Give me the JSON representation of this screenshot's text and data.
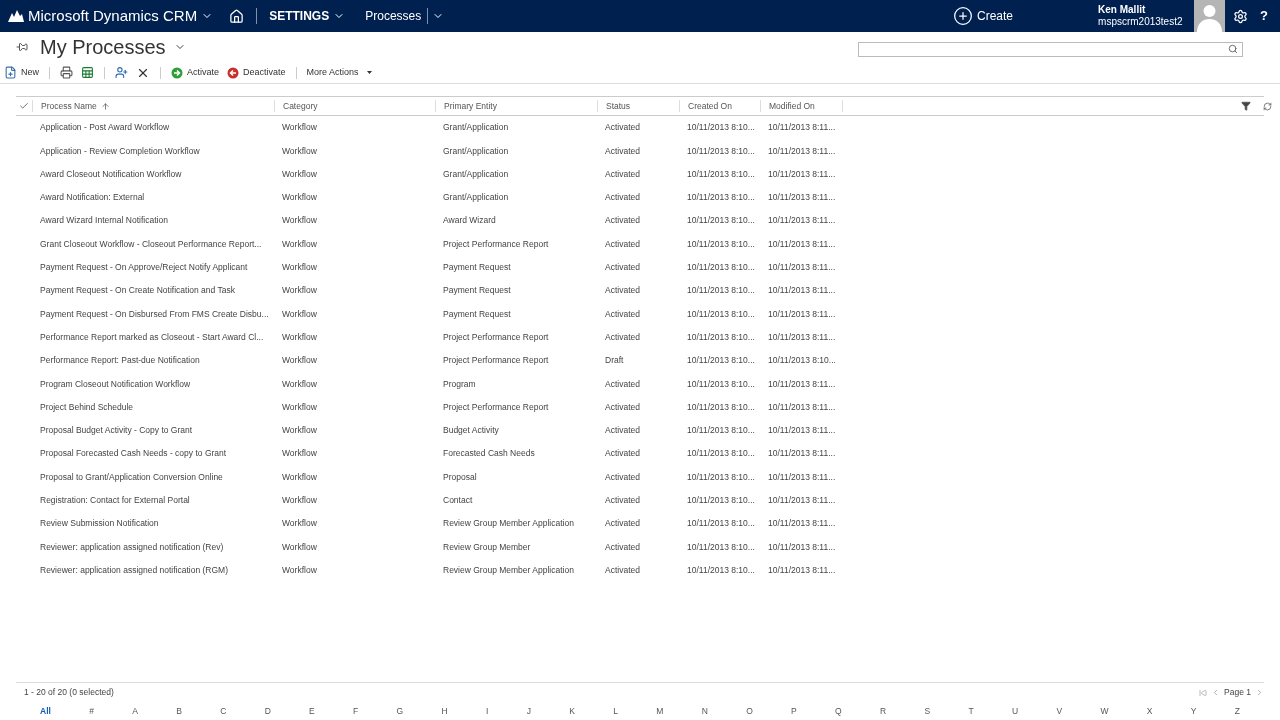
{
  "nav": {
    "brand": "Microsoft Dynamics CRM",
    "area": "SETTINGS",
    "entity": "Processes",
    "create": "Create",
    "user_name": "Ken Mallit",
    "org": "mspscrm2013test2",
    "help": "?"
  },
  "view": {
    "title": "My Processes"
  },
  "toolbar": [
    {
      "kind": "new",
      "label": "New"
    },
    {
      "kind": "print"
    },
    {
      "kind": "excel"
    },
    {
      "kind": "assign"
    },
    {
      "kind": "delete"
    },
    {
      "kind": "activate",
      "label": "Activate"
    },
    {
      "kind": "deactivate",
      "label": "Deactivate"
    },
    {
      "kind": "more",
      "label": "More Actions"
    }
  ],
  "table": {
    "select_all": {
      "checked": false
    },
    "columns": [
      {
        "label": "Process Name",
        "sorted": true
      },
      {
        "label": "Category",
        "sorted": false
      },
      {
        "label": "Primary Entity",
        "sorted": false
      },
      {
        "label": "Status",
        "sorted": false
      },
      {
        "label": "Created On",
        "sorted": false
      },
      {
        "label": "Modified On",
        "sorted": false
      }
    ],
    "rows": [
      {
        "name": "Application - Post Award Workflow",
        "category": "Workflow",
        "entity": "Grant/Application",
        "status": "Activated",
        "created": "10/11/2013 8:10...",
        "modified": "10/11/2013 8:11..."
      },
      {
        "name": "Application - Review Completion Workflow",
        "category": "Workflow",
        "entity": "Grant/Application",
        "status": "Activated",
        "created": "10/11/2013 8:10...",
        "modified": "10/11/2013 8:11..."
      },
      {
        "name": "Award Closeout Notification Workflow",
        "category": "Workflow",
        "entity": "Grant/Application",
        "status": "Activated",
        "created": "10/11/2013 8:10...",
        "modified": "10/11/2013 8:11..."
      },
      {
        "name": "Award Notification: External",
        "category": "Workflow",
        "entity": "Grant/Application",
        "status": "Activated",
        "created": "10/11/2013 8:10...",
        "modified": "10/11/2013 8:11..."
      },
      {
        "name": "Award Wizard Internal Notification",
        "category": "Workflow",
        "entity": "Award Wizard",
        "status": "Activated",
        "created": "10/11/2013 8:10...",
        "modified": "10/11/2013 8:11..."
      },
      {
        "name": "Grant Closeout Workflow - Closeout Performance Report...",
        "category": "Workflow",
        "entity": "Project Performance Report",
        "status": "Activated",
        "created": "10/11/2013 8:10...",
        "modified": "10/11/2013 8:11..."
      },
      {
        "name": "Payment Request - On Approve/Reject Notify Applicant",
        "category": "Workflow",
        "entity": "Payment Request",
        "status": "Activated",
        "created": "10/11/2013 8:10...",
        "modified": "10/11/2013 8:11..."
      },
      {
        "name": "Payment Request - On Create Notification and Task",
        "category": "Workflow",
        "entity": "Payment Request",
        "status": "Activated",
        "created": "10/11/2013 8:10...",
        "modified": "10/11/2013 8:11..."
      },
      {
        "name": "Payment Request - On Disbursed From FMS Create Disbu...",
        "category": "Workflow",
        "entity": "Payment Request",
        "status": "Activated",
        "created": "10/11/2013 8:10...",
        "modified": "10/11/2013 8:11..."
      },
      {
        "name": "Performance Report marked as Closeout - Start Award Cl...",
        "category": "Workflow",
        "entity": "Project Performance Report",
        "status": "Activated",
        "created": "10/11/2013 8:10...",
        "modified": "10/11/2013 8:11..."
      },
      {
        "name": "Performance Report: Past-due Notification",
        "category": "Workflow",
        "entity": "Project Performance Report",
        "status": "Draft",
        "created": "10/11/2013 8:10...",
        "modified": "10/11/2013 8:10..."
      },
      {
        "name": "Program Closeout Notification Workflow",
        "category": "Workflow",
        "entity": "Program",
        "status": "Activated",
        "created": "10/11/2013 8:10...",
        "modified": "10/11/2013 8:11..."
      },
      {
        "name": "Project Behind Schedule",
        "category": "Workflow",
        "entity": "Project Performance Report",
        "status": "Activated",
        "created": "10/11/2013 8:10...",
        "modified": "10/11/2013 8:11..."
      },
      {
        "name": "Proposal Budget Activity - Copy to Grant",
        "category": "Workflow",
        "entity": "Budget Activity",
        "status": "Activated",
        "created": "10/11/2013 8:10...",
        "modified": "10/11/2013 8:11..."
      },
      {
        "name": "Proposal Forecasted Cash Needs - copy to Grant",
        "category": "Workflow",
        "entity": "Forecasted Cash Needs",
        "status": "Activated",
        "created": "10/11/2013 8:10...",
        "modified": "10/11/2013 8:11..."
      },
      {
        "name": "Proposal to Grant/Application Conversion Online",
        "category": "Workflow",
        "entity": "Proposal",
        "status": "Activated",
        "created": "10/11/2013 8:10...",
        "modified": "10/11/2013 8:11..."
      },
      {
        "name": "Registration: Contact for External Portal",
        "category": "Workflow",
        "entity": "Contact",
        "status": "Activated",
        "created": "10/11/2013 8:10...",
        "modified": "10/11/2013 8:11..."
      },
      {
        "name": "Review Submission Notification",
        "category": "Workflow",
        "entity": "Review Group Member Application",
        "status": "Activated",
        "created": "10/11/2013 8:10...",
        "modified": "10/11/2013 8:11..."
      },
      {
        "name": "Reviewer: application assigned notification (Rev)",
        "category": "Workflow",
        "entity": "Review Group Member",
        "status": "Activated",
        "created": "10/11/2013 8:10...",
        "modified": "10/11/2013 8:11..."
      },
      {
        "name": "Reviewer: application assigned notification (RGM)",
        "category": "Workflow",
        "entity": "Review Group Member Application",
        "status": "Activated",
        "created": "10/11/2013 8:10...",
        "modified": "10/11/2013 8:11..."
      }
    ]
  },
  "status_bar": {
    "count": "1 - 20 of 20 (0 selected)",
    "page": "Page 1"
  },
  "index": [
    {
      "label": "All",
      "selected": true
    },
    {
      "label": "#",
      "selected": false
    },
    {
      "label": "A",
      "selected": false
    },
    {
      "label": "B",
      "selected": false
    },
    {
      "label": "C",
      "selected": false
    },
    {
      "label": "D",
      "selected": false
    },
    {
      "label": "E",
      "selected": false
    },
    {
      "label": "F",
      "selected": false
    },
    {
      "label": "G",
      "selected": false
    },
    {
      "label": "H",
      "selected": false
    },
    {
      "label": "I",
      "selected": false
    },
    {
      "label": "J",
      "selected": false
    },
    {
      "label": "K",
      "selected": false
    },
    {
      "label": "L",
      "selected": false
    },
    {
      "label": "M",
      "selected": false
    },
    {
      "label": "N",
      "selected": false
    },
    {
      "label": "O",
      "selected": false
    },
    {
      "label": "P",
      "selected": false
    },
    {
      "label": "Q",
      "selected": false
    },
    {
      "label": "R",
      "selected": false
    },
    {
      "label": "S",
      "selected": false
    },
    {
      "label": "T",
      "selected": false
    },
    {
      "label": "U",
      "selected": false
    },
    {
      "label": "V",
      "selected": false
    },
    {
      "label": "W",
      "selected": false
    },
    {
      "label": "X",
      "selected": false
    },
    {
      "label": "Y",
      "selected": false
    },
    {
      "label": "Z",
      "selected": false
    }
  ]
}
